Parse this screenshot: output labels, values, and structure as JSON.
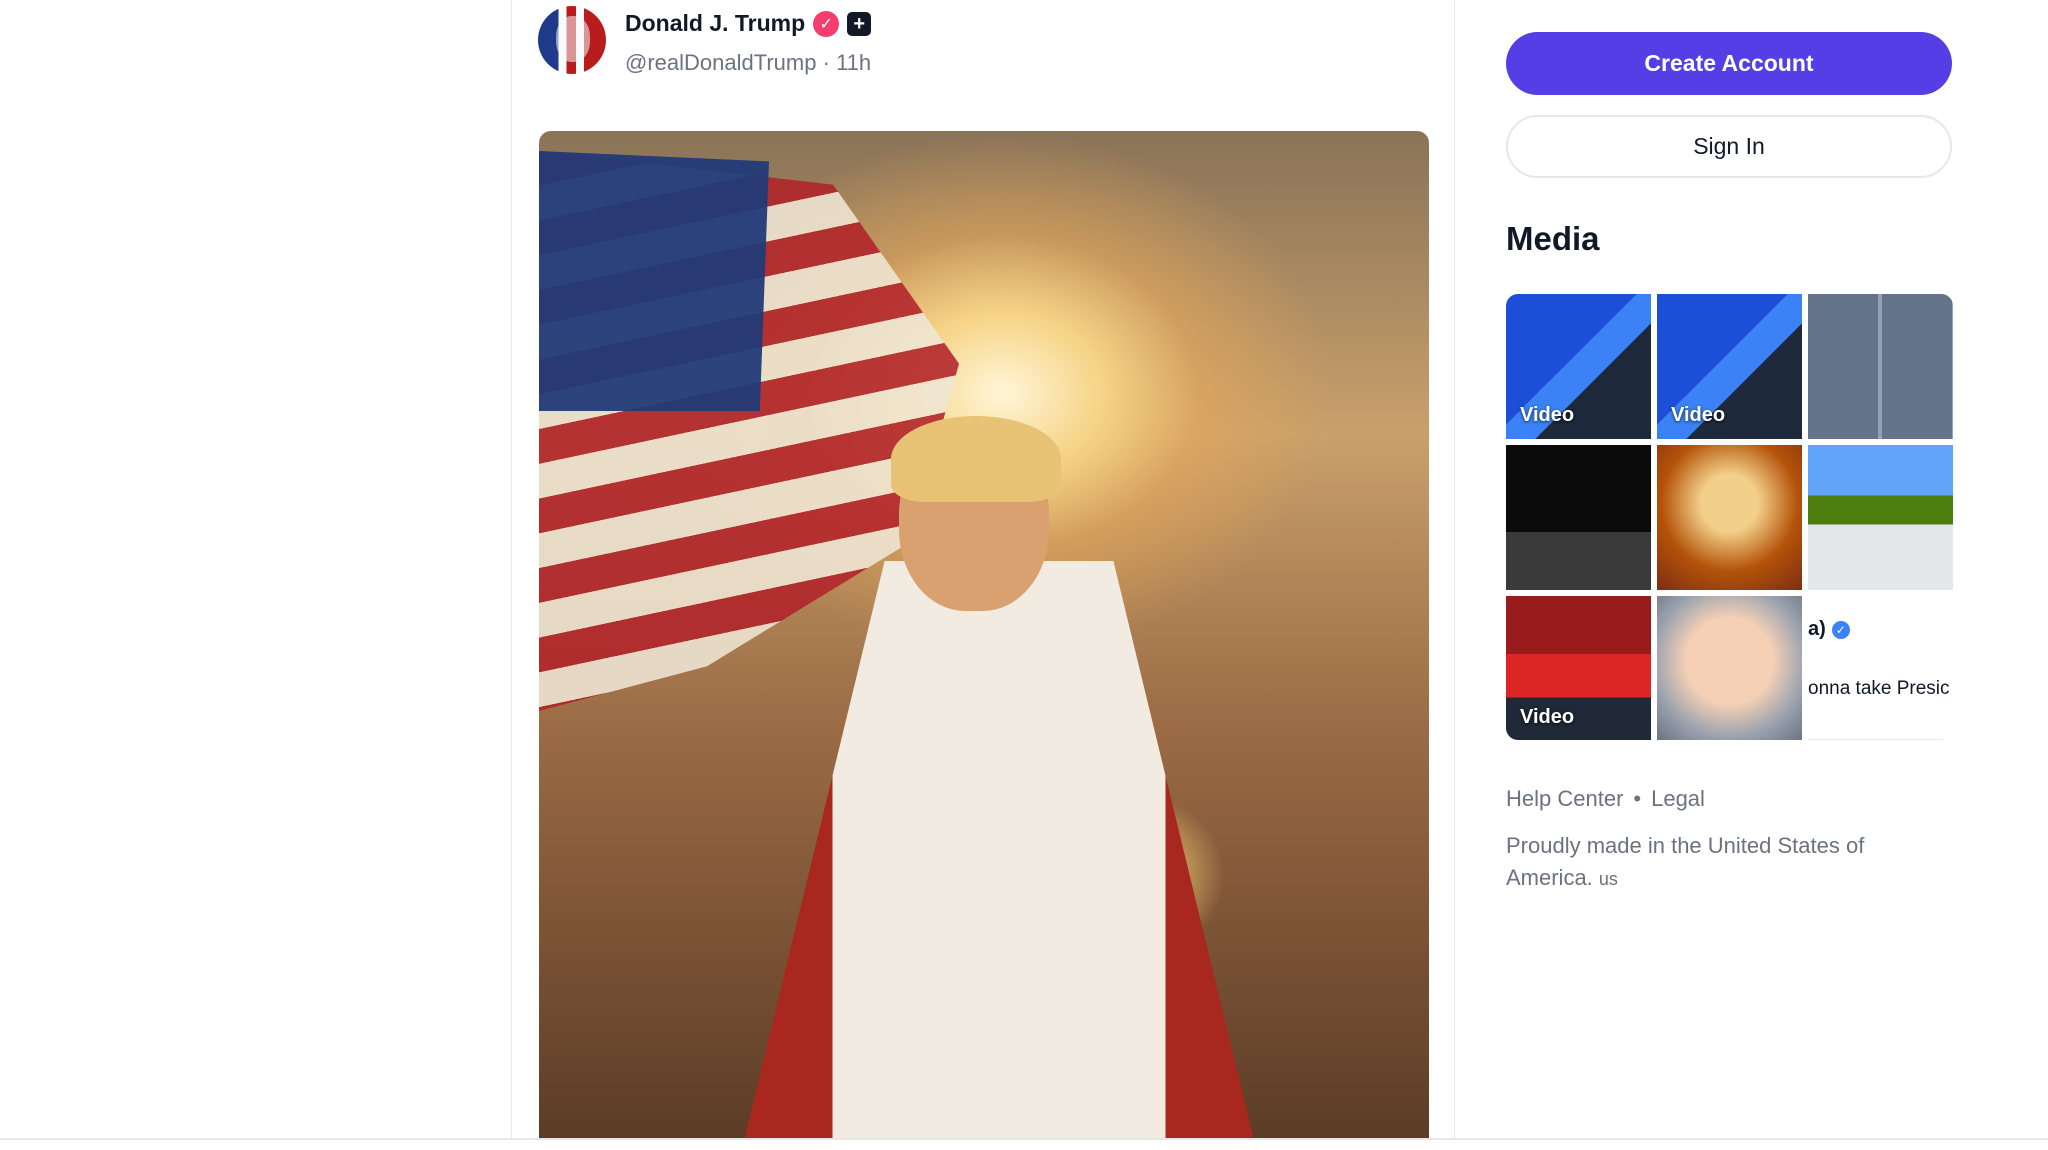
{
  "post": {
    "author_name": "Donald J. Trump",
    "handle": "@realDonaldTrump",
    "separator": "·",
    "time_ago": "11h",
    "verified_badge_icon": "verified-check-icon",
    "plus_badge_icon": "plus-badge-icon",
    "plus_badge_glyph": "+",
    "verified_glyph": "✓"
  },
  "sidebar": {
    "create_account_label": "Create Account",
    "sign_in_label": "Sign In",
    "media_heading": "Media",
    "media_tiles": [
      {
        "label": "Video"
      },
      {
        "label": "Video"
      },
      {
        "label": ""
      },
      {
        "label": ""
      },
      {
        "label": ""
      },
      {
        "label": ""
      },
      {
        "label": "Video"
      },
      {
        "label": ""
      },
      {
        "label": "",
        "snippet_top": "a)",
        "snippet_bottom": "onna take Presic"
      }
    ],
    "check_glyph": "✓",
    "footer": {
      "help_center": "Help Center",
      "dot": "•",
      "legal": "Legal",
      "tagline": "Proudly made in the United States of America.",
      "country_code": "us"
    }
  },
  "colors": {
    "accent": "#563ee6",
    "verified": "#f43f6e",
    "muted_text": "#6b7280",
    "border": "#e5e7eb"
  }
}
